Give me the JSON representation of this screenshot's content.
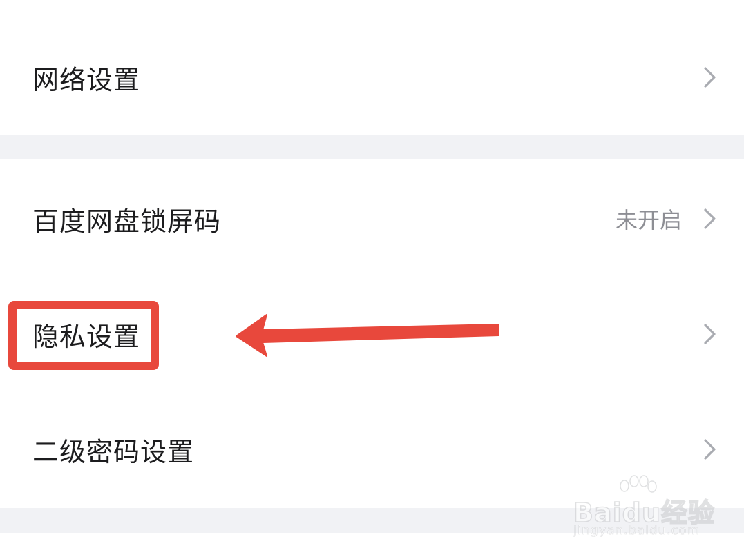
{
  "settings": {
    "group1": [
      {
        "label": "网络设置",
        "value": ""
      }
    ],
    "group2": [
      {
        "label": "百度网盘锁屏码",
        "value": "未开启"
      },
      {
        "label": "隐私设置",
        "value": ""
      },
      {
        "label": "二级密码设置",
        "value": ""
      }
    ]
  },
  "icons": {
    "row_chevron": "chevron-right-icon",
    "annotation_arrow": "arrow-left-icon",
    "watermark_paw": "paw-icon"
  },
  "annotation": {
    "highlighted_item": "隐私设置",
    "color": "#e8483c"
  },
  "watermark": {
    "brand": "Baidu经验",
    "url": "jingyan.baidu.com"
  },
  "colors": {
    "background": "#ffffff",
    "group_gap": "#f1f2f5",
    "text_primary": "#1c1c1e",
    "text_secondary": "#8d8e94",
    "chevron": "#a9abb1"
  }
}
